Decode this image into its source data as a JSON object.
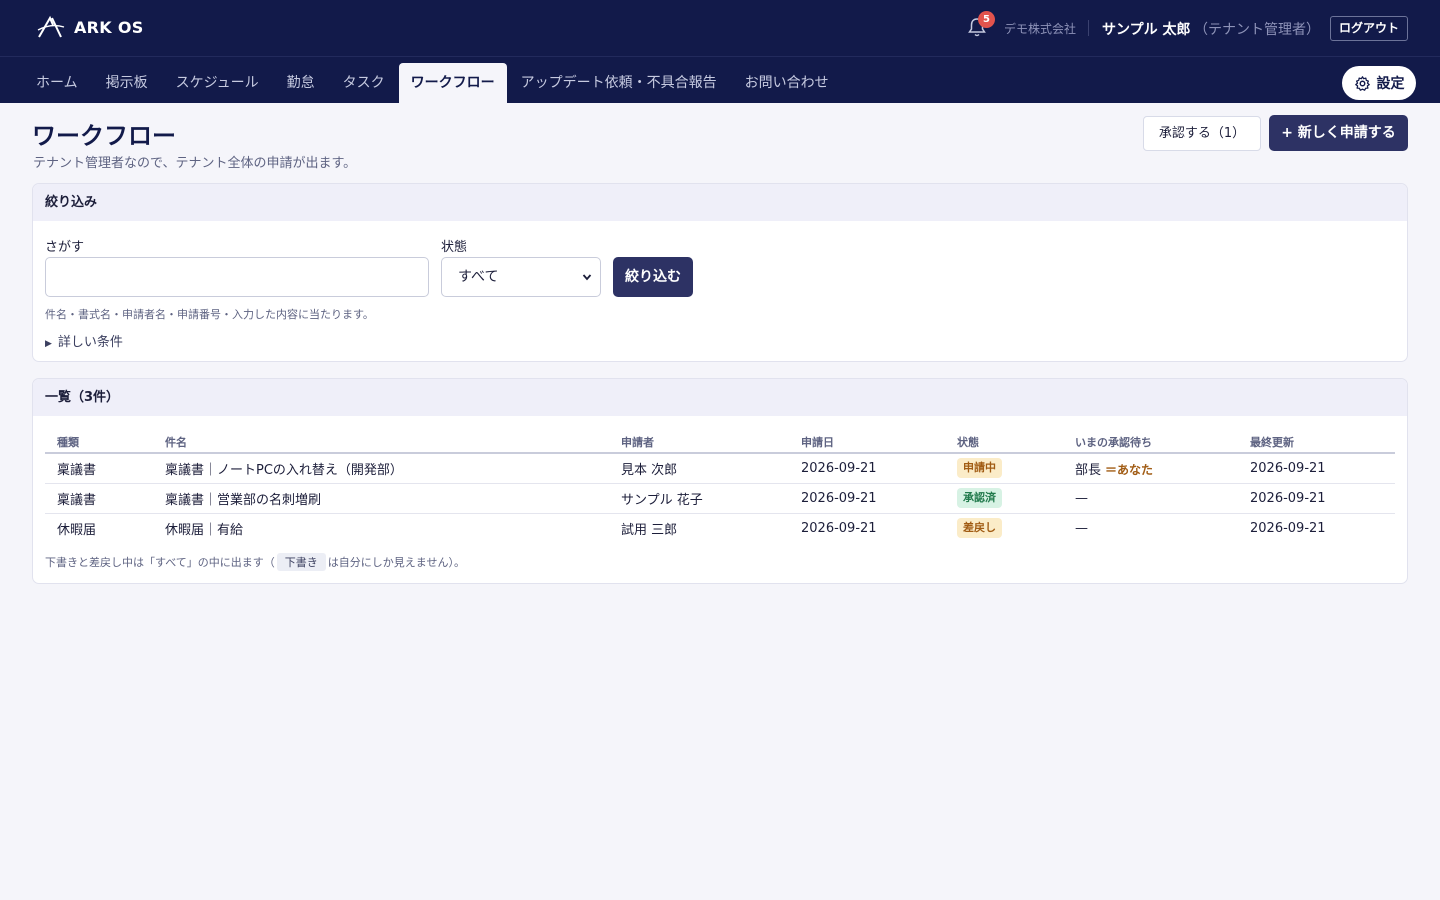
{
  "header": {
    "brand": "ARK OS",
    "notification_count": "5",
    "company": "デモ株式会社",
    "user_name": "サンプル 太郎",
    "user_role": "（テナント管理者）",
    "logout_label": "ログアウト",
    "settings_label": "設定"
  },
  "nav": {
    "items": [
      {
        "label": "ホーム"
      },
      {
        "label": "掲示板"
      },
      {
        "label": "スケジュール"
      },
      {
        "label": "勤怠"
      },
      {
        "label": "タスク"
      },
      {
        "label": "ワークフロー"
      },
      {
        "label": "アップデート依頼・不具合報告"
      },
      {
        "label": "お問い合わせ"
      }
    ],
    "active": "ワークフロー"
  },
  "page": {
    "title": "ワークフロー",
    "subtitle": "テナント管理者なので、テナント全体の申請が出ます。",
    "approve_label": "承認する（1）",
    "new_label": "+ 新しく申請する"
  },
  "filter": {
    "heading": "絞り込み",
    "search_label": "さがす",
    "search_value": "",
    "search_placeholder": "",
    "state_label": "状態",
    "state_value": "すべて",
    "button_label": "絞り込む",
    "hint": "件名・書式名・申請者名・申請番号・入力した内容に当たります。",
    "details_label": "詳しい条件"
  },
  "list": {
    "heading": "一覧（3件）",
    "columns": [
      "種類",
      "件名",
      "申請者",
      "申請日",
      "状態",
      "いまの承認待ち",
      "最終更新"
    ],
    "rows": [
      {
        "type": "稟議書",
        "subject": "稟議書｜ノートPCの入れ替え（開発部）",
        "applicant": "見本 次郎",
        "date": "2026-09-21",
        "status": "申請中",
        "status_color": "#fbecc8",
        "status_text_color": "#a15c14",
        "waiting": "部長",
        "waiting_note": "＝あなた",
        "updated": "2026-09-21"
      },
      {
        "type": "稟議書",
        "subject": "稟議書｜営業部の名刺増刷",
        "applicant": "サンプル 花子",
        "date": "2026-09-21",
        "status": "承認済",
        "status_color": "#d7f2e4",
        "status_text_color": "#217a4c",
        "waiting": "—",
        "waiting_note": "",
        "updated": "2026-09-21"
      },
      {
        "type": "休暇届",
        "subject": "休暇届｜有給",
        "applicant": "試用 三郎",
        "date": "2026-09-21",
        "status": "差戻し",
        "status_color": "#fbecc8",
        "status_text_color": "#a15c14",
        "waiting": "—",
        "waiting_note": "",
        "updated": "2026-09-21"
      }
    ],
    "footnote_before": "下書きと差戻し中は「すべて」の中に出ます（",
    "footnote_chip": "下書き",
    "footnote_after": "は自分にしか見えません）。"
  },
  "colors": {
    "header_bg": "#121a4a",
    "primary_button": "#2d3264",
    "badge": "#e2534d"
  }
}
